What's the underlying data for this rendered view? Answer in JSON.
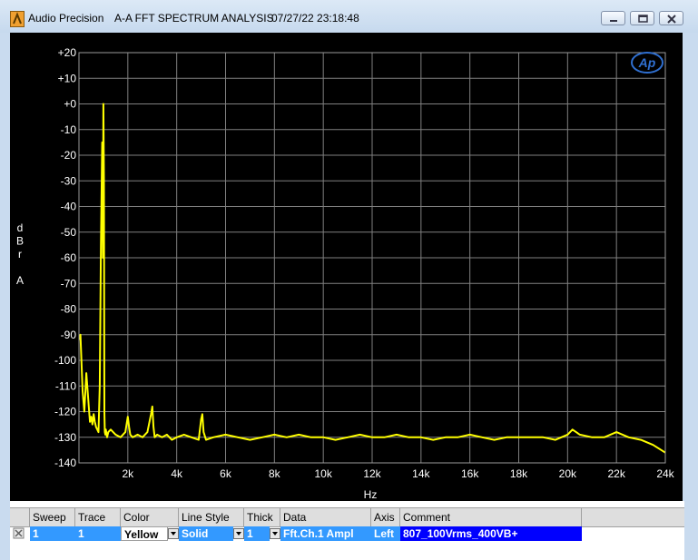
{
  "window": {
    "app_name": "Audio Precision",
    "title": "A-A FFT SPECTRUM ANALYSIS",
    "datetime": "07/27/22 23:18:48",
    "controls": [
      "minimize",
      "restore",
      "close"
    ]
  },
  "logo_text": "Ap",
  "colors": {
    "background": "#000000",
    "grid": "#808080",
    "trace": "#ffff00",
    "axis_text": "#ffffff",
    "comment_bg": "#0000ff",
    "selection": "#3399ff"
  },
  "chart_data": {
    "type": "line",
    "title": "",
    "xlabel": "Hz",
    "ylabel": "dBr A",
    "xlim": [
      0,
      24000
    ],
    "ylim": [
      -140,
      20
    ],
    "x_ticks": [
      2000,
      4000,
      6000,
      8000,
      10000,
      12000,
      14000,
      16000,
      18000,
      20000,
      22000,
      24000
    ],
    "x_tick_labels": [
      "2k",
      "4k",
      "6k",
      "8k",
      "10k",
      "12k",
      "14k",
      "16k",
      "18k",
      "20k",
      "22k",
      "24k"
    ],
    "y_ticks": [
      20,
      10,
      0,
      -10,
      -20,
      -30,
      -40,
      -50,
      -60,
      -70,
      -80,
      -90,
      -100,
      -110,
      -120,
      -130,
      -140
    ],
    "y_tick_labels": [
      "+20",
      "+10",
      "+0",
      "-10",
      "-20",
      "-30",
      "-40",
      "-50",
      "-60",
      "-70",
      "-80",
      "-90",
      "-100",
      "-110",
      "-120",
      "-130",
      "-140"
    ],
    "grid": true,
    "series": [
      {
        "name": "Fft.Ch.1 Ampl",
        "color": "#ffff00",
        "x": [
          20,
          60,
          100,
          150,
          220,
          300,
          400,
          450,
          500,
          550,
          600,
          650,
          700,
          750,
          800,
          850,
          900,
          950,
          980,
          1000,
          1020,
          1040,
          1060,
          1080,
          1100,
          1150,
          1200,
          1300,
          1500,
          1700,
          1900,
          2000,
          2050,
          2100,
          2200,
          2400,
          2600,
          2800,
          2950,
          3000,
          3050,
          3100,
          3200,
          3400,
          3600,
          3800,
          4000,
          4300,
          4600,
          4900,
          5000,
          5050,
          5100,
          5200,
          5500,
          6000,
          6500,
          7000,
          7500,
          8000,
          8500,
          9000,
          9500,
          10000,
          10500,
          11000,
          11500,
          12000,
          12500,
          13000,
          13500,
          14000,
          14500,
          15000,
          15500,
          16000,
          16500,
          17000,
          17500,
          18000,
          18500,
          19000,
          19500,
          20000,
          20200,
          20500,
          21000,
          21500,
          22000,
          22500,
          23000,
          23500,
          24000
        ],
        "y": [
          -92,
          -90,
          -100,
          -112,
          -120,
          -105,
          -118,
          -124,
          -122,
          -125,
          -121,
          -124,
          -126,
          -127,
          -128,
          -110,
          -55,
          -15,
          -60,
          0,
          -30,
          -120,
          -128,
          -129,
          -127,
          -130,
          -128,
          -127,
          -129,
          -130,
          -128,
          -122,
          -126,
          -129,
          -130,
          -129,
          -130,
          -128,
          -121,
          -118,
          -126,
          -130,
          -129,
          -130,
          -129,
          -131,
          -130,
          -129,
          -130,
          -131,
          -123,
          -121,
          -128,
          -131,
          -130,
          -129,
          -130,
          -131,
          -130,
          -129,
          -130,
          -129,
          -130,
          -130,
          -131,
          -130,
          -129,
          -130,
          -130,
          -129,
          -130,
          -130,
          -131,
          -130,
          -130,
          -129,
          -130,
          -131,
          -130,
          -130,
          -130,
          -130,
          -131,
          -129,
          -127,
          -129,
          -130,
          -130,
          -128,
          -130,
          -131,
          -133,
          -136
        ]
      }
    ]
  },
  "table": {
    "headers": [
      "Sweep",
      "Trace",
      "Color",
      "Line Style",
      "Thick",
      "Data",
      "Axis",
      "Comment"
    ],
    "row": {
      "sweep": "1",
      "trace": "1",
      "color": "Yellow",
      "line_style": "Solid",
      "thick": "1",
      "data": "Fft.Ch.1 Ampl",
      "axis": "Left",
      "comment": "807_100Vrms_400VB+"
    }
  }
}
